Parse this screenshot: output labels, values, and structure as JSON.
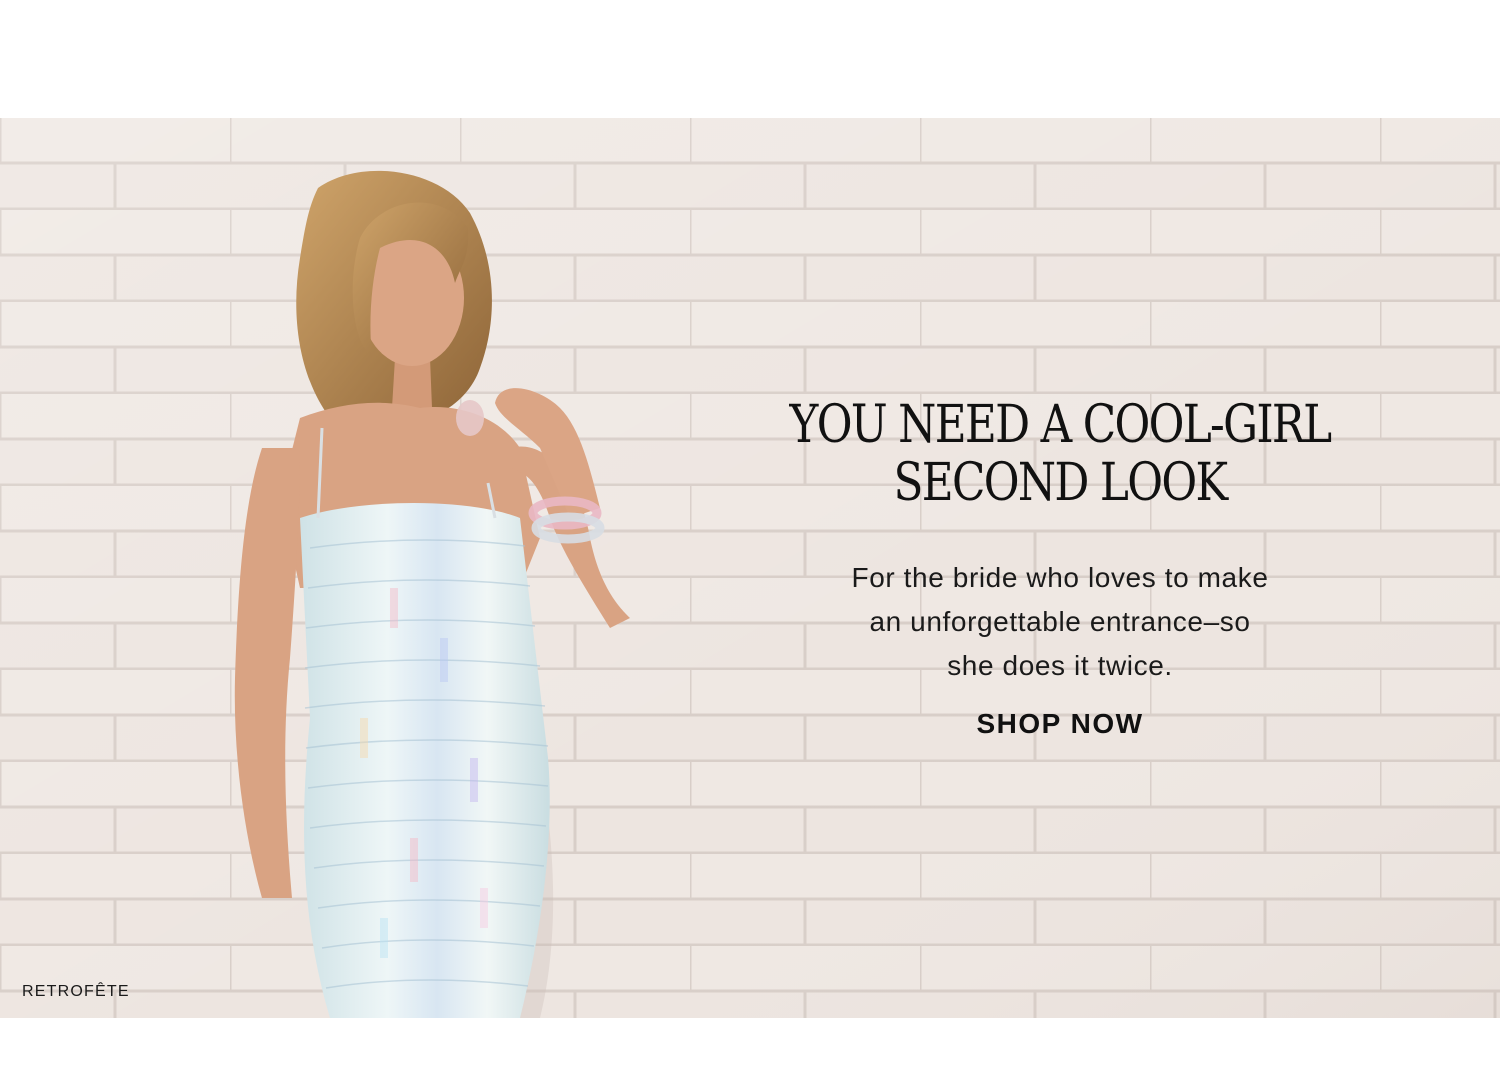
{
  "hero": {
    "headline": {
      "line1": "YOU NEED A COOL-GIRL",
      "line2": "SECOND LOOK"
    },
    "subcopy": {
      "line1": "For the bride who loves to make",
      "line2": "an unforgettable entrance–so",
      "line3": "she does it twice."
    },
    "cta_label": "SHOP NOW",
    "brand_credit": "RETROFÊTE",
    "image_alt": "Model in iridescent sequin slip dress leaning against a white brick wall"
  },
  "colors": {
    "page_background": "#ffffff",
    "wall": "#ece4df",
    "mortar": "#d9cfca",
    "text": "#111111",
    "dress": "#e4eef0",
    "skin": "#d9a383",
    "hair": "#b98a52"
  }
}
